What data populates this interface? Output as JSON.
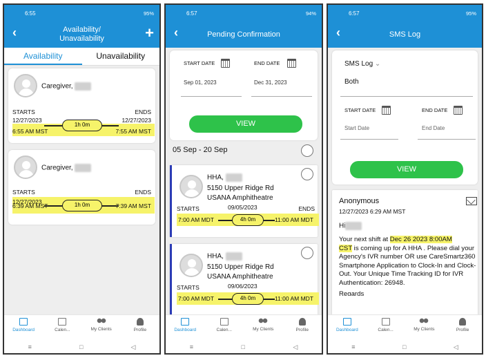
{
  "screens": {
    "availability": {
      "status_time": "6:55",
      "status_right": "95%",
      "title_line1": "Availability/",
      "title_line2": "Unavailability",
      "tabs": [
        "Availability",
        "Unavailability"
      ],
      "cards": [
        {
          "name": "Caregiver,",
          "starts_label": "STARTS",
          "ends_label": "ENDS",
          "start_date": "12/27/2023",
          "start_time": "6:55 AM MST",
          "duration": "1h 0m",
          "end_date": "12/27/2023",
          "end_time": "7:55 AM MST"
        },
        {
          "name": "Caregiver,",
          "starts_label": "STARTS",
          "ends_label": "ENDS",
          "start_date": "12/27/2023",
          "start_time": "6:39 AM MST",
          "duration": "1h 0m",
          "end_date": "12/27/2023",
          "end_time": "7:39 AM MST"
        }
      ]
    },
    "pending": {
      "status_time": "6:57",
      "status_right": "94%",
      "title": "Pending Confirmation",
      "start_label": "START DATE",
      "start_value": "Sep 01, 2023",
      "end_label": "END DATE",
      "end_value": "Dec 31, 2023",
      "view_button": "VIEW",
      "range_header": "05 Sep - 20 Sep",
      "visits": [
        {
          "name": "HHA,",
          "address1": "5150 Upper Ridge Rd",
          "address2": "USANA Amphitheatre",
          "starts_label": "STARTS",
          "date": "09/05/2023",
          "ends_label": "ENDS",
          "start_time": "7:00 AM MDT",
          "duration": "4h 0m",
          "end_time": "11:00 AM MDT"
        },
        {
          "name": "HHA,",
          "address1": "5150 Upper Ridge Rd",
          "address2": "USANA Amphitheatre",
          "starts_label": "STARTS",
          "date": "09/06/2023",
          "ends_label": "ENDS",
          "start_time": "7:00 AM MDT",
          "duration": "4h 0m",
          "end_time": "11:00 AM MDT"
        }
      ]
    },
    "sms": {
      "status_time": "6:57",
      "status_right": "95%",
      "title": "SMS Log",
      "dropdown_label": "SMS Log",
      "dropdown_value": "Both",
      "start_label": "START DATE",
      "start_placeholder": "Start Date",
      "end_label": "END DATE",
      "end_placeholder": "End Date",
      "view_button": "VIEW",
      "message": {
        "sender": "Anonymous",
        "timestamp": "12/27/2023 6:29 AM MST",
        "greeting": "Hi",
        "line1_pre": "Your next shift at ",
        "line1_hl": "Dec 26 2023  8:00AM",
        "line2_hl": "CST",
        "line2_post": " is coming up for A HHA .",
        "body": "Please dial your Agency's IVR number OR use CareSmartz360 Smartphone Application to Clock-In and Clock-Out. Your Unique Time Tracking ID for IVR Authentication: 26948.",
        "trailing": "Regards"
      }
    }
  },
  "bottom_nav": [
    "Dashboard",
    "Calen...",
    "My Clients",
    "Profile"
  ],
  "colors": {
    "primary": "#1e90d6",
    "highlight": "#f6f36a",
    "green": "#2ec24a",
    "accent_bar": "#2b3bb5"
  }
}
